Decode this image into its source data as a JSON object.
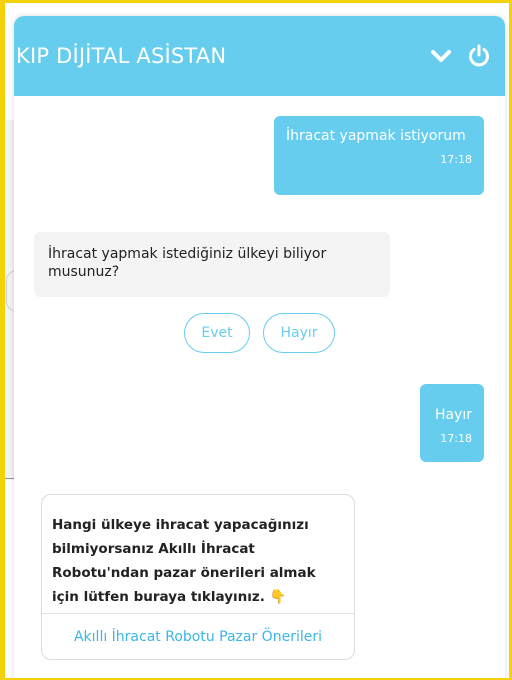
{
  "header": {
    "title": "KIP DİJİTAL ASİSTAN",
    "minimize_icon": "chevron-down-icon",
    "power_icon": "power-icon"
  },
  "messages": [
    {
      "role": "user",
      "text": "İhracat yapmak istiyorum",
      "time": "17:18"
    },
    {
      "role": "bot",
      "text": "İhracat yapmak istediğiniz ülkeyi biliyor musunuz?"
    },
    {
      "role": "user",
      "text": "Hayır",
      "time": "17:18"
    }
  ],
  "quick_replies": [
    "Evet",
    "Hayır"
  ],
  "card": {
    "text": "Hangi ülkeye ihracat yapacağınızı bilmiyorsanız Akıllı İhracat Robotu'ndan pazar önerileri almak için lütfen buraya tıklayınız.",
    "emoji": "👇",
    "link_label": "Akıllı İhracat Robotu Pazar Önerileri"
  },
  "colors": {
    "accent": "#66cdef",
    "frame": "#f5d10a",
    "bot_bubble": "#f4f4f4"
  }
}
